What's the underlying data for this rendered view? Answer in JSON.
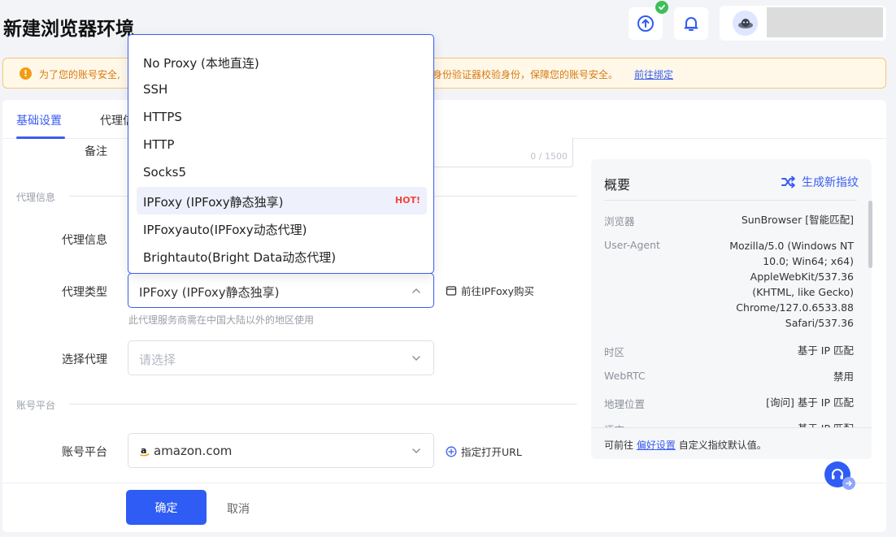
{
  "page": {
    "title": "新建浏览器环境"
  },
  "notice": {
    "text_left": "为了您的账号安全,",
    "text_right": "身份验证器校验身份，保障您的账号安全。",
    "link": "前往绑定"
  },
  "tabs": [
    {
      "label": "基础设置",
      "active": true
    },
    {
      "label": "代理信",
      "active": false
    }
  ],
  "form": {
    "remark": {
      "label": "备注",
      "count": "0 / 1500"
    },
    "section_proxy": "代理信息",
    "proxy_info": {
      "label": "代理信息"
    },
    "proxy_type": {
      "label": "代理类型",
      "value": "IPFoxy (IPFoxy静态独享)",
      "side_link": "前往IPFoxy购买",
      "hint": "此代理服务商需在中国大陆以外的地区使用"
    },
    "select_proxy": {
      "label": "选择代理",
      "placeholder": "请选择"
    },
    "section_account": "账号平台",
    "account_platform": {
      "label": "账号平台",
      "value": "amazon.com",
      "side_link": "指定打开URL"
    }
  },
  "dropdown": {
    "options": [
      {
        "label": "No Proxy (本地直连)"
      },
      {
        "label": "SSH"
      },
      {
        "label": "HTTPS"
      },
      {
        "label": "HTTP"
      },
      {
        "label": "Socks5"
      },
      {
        "label": "IPFoxy (IPFoxy静态独享)",
        "selected": true,
        "badge": "HOT!"
      },
      {
        "label": "IPFoxyauto(IPFoxy动态代理)"
      },
      {
        "label": "Brightauto(Bright Data动态代理)"
      }
    ]
  },
  "footer": {
    "confirm": "确定",
    "cancel": "取消"
  },
  "overview": {
    "title": "概要",
    "generate": "生成新指纹",
    "rows": [
      {
        "label": "浏览器",
        "value": "SunBrowser [智能匹配]"
      },
      {
        "label": "User-Agent",
        "value_lines": [
          "Mozilla/5.0 (Windows NT",
          "10.0; Win64; x64)",
          "AppleWebKit/537.36",
          "(KHTML, like Gecko)",
          "Chrome/127.0.6533.88",
          "Safari/537.36"
        ]
      },
      {
        "label": "时区",
        "value": "基于 IP 匹配"
      },
      {
        "label": "WebRTC",
        "value": "禁用"
      },
      {
        "label": "地理位置",
        "value": "[询问] 基于 IP 匹配"
      },
      {
        "label": "语言",
        "value": "基于 IP 匹配"
      }
    ],
    "footer_prefix": "可前往",
    "footer_link": "偏好设置",
    "footer_suffix": "自定义指纹默认值。"
  },
  "colors": {
    "accent": "#3a5df0",
    "primary_button": "#2f5cf4",
    "hot": "#f0443c",
    "notice_bg": "#fff8e8",
    "success": "#3dbf5a"
  },
  "icons": [
    "sync-icon",
    "check-badge-icon",
    "bell-icon",
    "avatar-icon",
    "warning-icon",
    "chevron-up-icon",
    "chevron-down-icon",
    "external-window-icon",
    "plus-circle-icon",
    "shuffle-icon",
    "headset-icon",
    "arrow-right-icon",
    "amazon-logo-icon"
  ]
}
